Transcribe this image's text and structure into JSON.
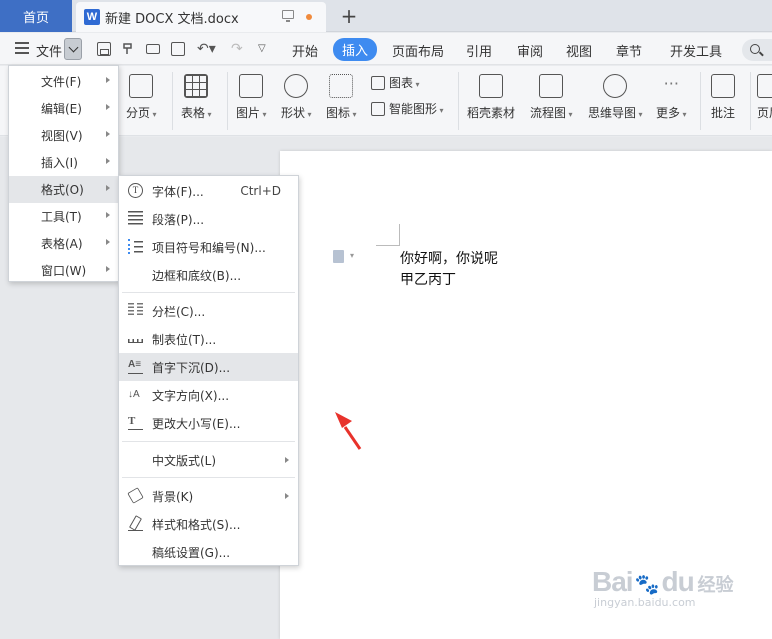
{
  "tabbar": {
    "home_tab": "首页",
    "doc_tab_icon": "W",
    "doc_tab_title": "新建 DOCX 文档.docx"
  },
  "menubar": {
    "file_label": "文件",
    "tabs": [
      "开始",
      "插入",
      "页面布局",
      "引用",
      "审阅",
      "视图",
      "章节",
      "开发工具"
    ],
    "active_tab": "插入"
  },
  "ribbon": {
    "buttons": [
      {
        "label": "分页",
        "icon": "page-break-icon"
      },
      {
        "label": "表格",
        "icon": "table-icon"
      },
      {
        "label": "图片",
        "icon": "picture-icon"
      },
      {
        "label": "形状",
        "icon": "shape-icon"
      },
      {
        "label": "图标",
        "icon": "icons-icon"
      },
      {
        "label": "稻壳素材",
        "icon": "docer-material-icon"
      },
      {
        "label": "流程图",
        "icon": "flowchart-icon"
      },
      {
        "label": "思维导图",
        "icon": "mindmap-icon"
      },
      {
        "label": "更多",
        "icon": "more-icon"
      },
      {
        "label": "批注",
        "icon": "comment-icon"
      },
      {
        "label": "页眉",
        "icon": "header-icon"
      }
    ],
    "small_buttons": [
      {
        "label": "图表",
        "icon": "chart-icon"
      },
      {
        "label": "智能图形",
        "icon": "smart-graphic-icon"
      }
    ]
  },
  "file_menu": {
    "items": [
      "文件(F)",
      "编辑(E)",
      "视图(V)",
      "插入(I)",
      "格式(O)",
      "工具(T)",
      "表格(A)",
      "窗口(W)"
    ],
    "highlighted": "格式(O)"
  },
  "format_submenu": {
    "items": [
      {
        "label": "字体(F)...",
        "shortcut": "Ctrl+D"
      },
      {
        "label": "段落(P)..."
      },
      {
        "label": "项目符号和编号(N)..."
      },
      {
        "label": "边框和底纹(B)..."
      },
      {
        "label": "分栏(C)..."
      },
      {
        "label": "制表位(T)..."
      },
      {
        "label": "首字下沉(D)..."
      },
      {
        "label": "文字方向(X)..."
      },
      {
        "label": "更改大小写(E)..."
      },
      {
        "label": "中文版式(L)"
      },
      {
        "label": "背景(K)"
      },
      {
        "label": "样式和格式(S)..."
      },
      {
        "label": "稿纸设置(G)..."
      }
    ],
    "highlighted": "首字下沉(D)..."
  },
  "document": {
    "lines": [
      "你好啊，你说呢",
      "甲乙丙丁"
    ]
  },
  "watermark": {
    "logo": "Bai",
    "logo_suffix": "du",
    "text": "经验",
    "url": "jingyan.baidu.com"
  },
  "colors": {
    "accent": "#3e8bf0",
    "home_tab": "#3e6fc5",
    "arrow": "#e8322b"
  }
}
